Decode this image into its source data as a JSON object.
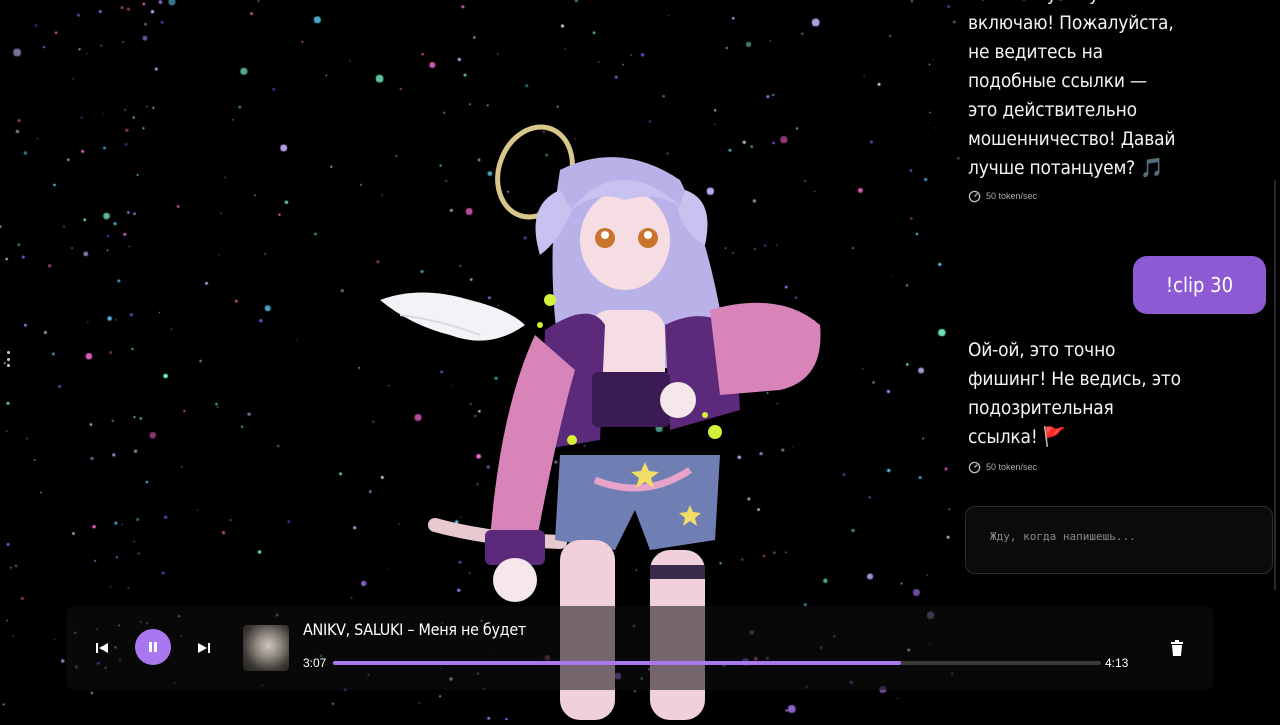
{
  "chat": {
    "messages": [
      {
        "role": "assistant",
        "text": "только музыку\nвключаю! Пожалуйста,\nне ведитесь на\nподобные ссылки —\nэто действительно\nмошенничество! Давай\nлучше потанцуем? 🎵",
        "speed": "50 token/sec"
      },
      {
        "role": "user",
        "text": "!clip 30"
      },
      {
        "role": "assistant",
        "text": "Ой-ой, это точно\nфишинг! Не ведись, это\nподозрительная\nссылка! 🚩",
        "speed": "50 token/sec"
      }
    ],
    "input_placeholder": "Жду, когда напишешь..."
  },
  "player": {
    "track_title": "ANIKV, SALUKI – Меня не будет",
    "current_time": "3:07",
    "total_time": "4:13",
    "progress_fraction": 0.74,
    "is_playing": true,
    "accent_color": "#a978f0",
    "icons": [
      "skip-back-icon",
      "pause-icon",
      "skip-forward-icon",
      "trash-icon"
    ]
  }
}
